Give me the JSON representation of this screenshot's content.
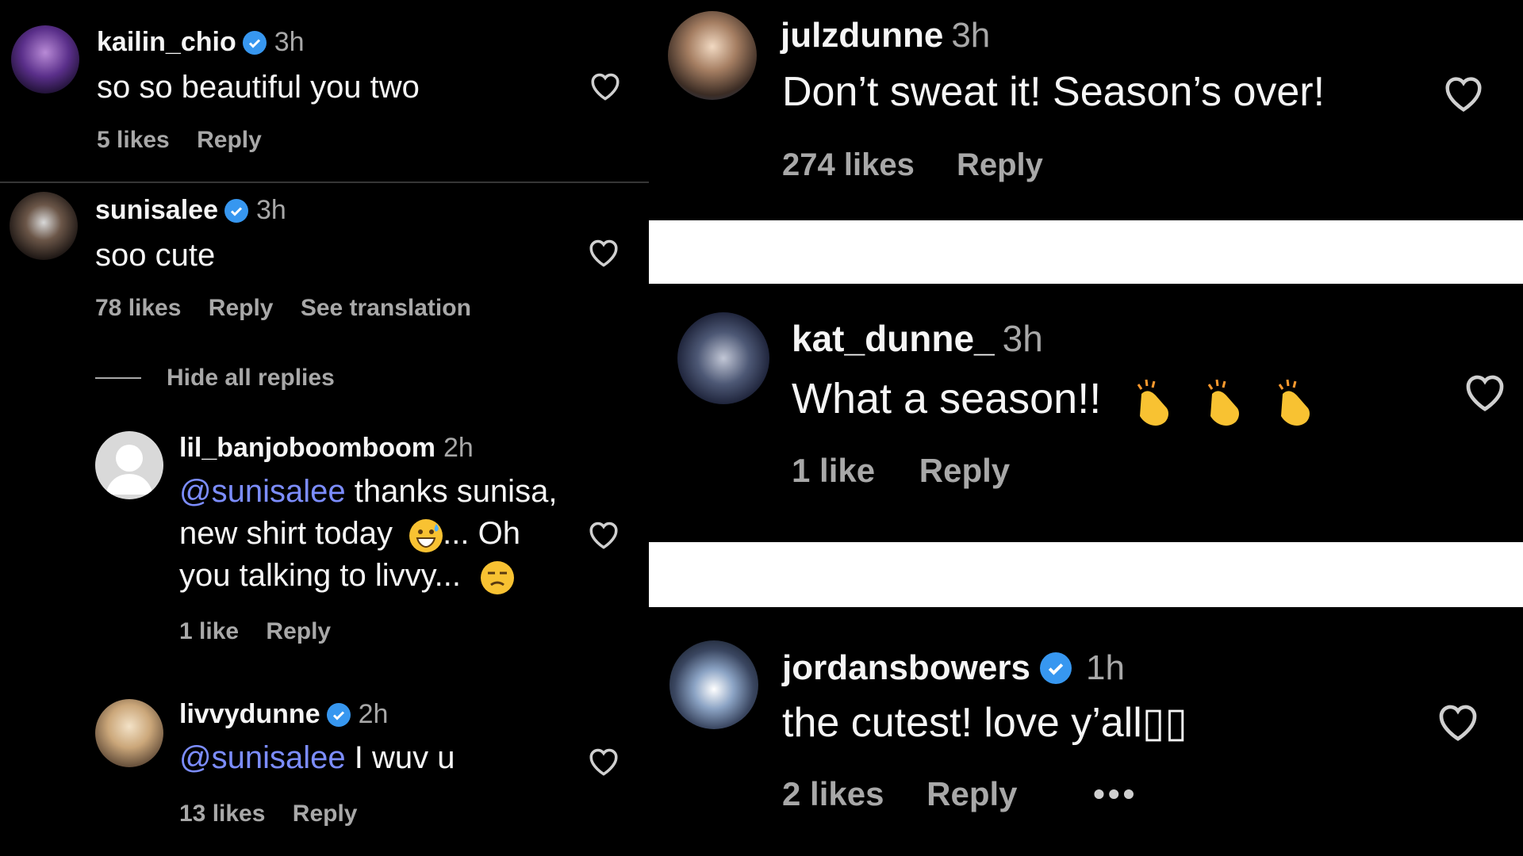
{
  "left_panel": {
    "comments": [
      {
        "username": "kailin_chio",
        "verified": true,
        "time": "3h",
        "text": "so so beautiful you two",
        "likes": "5 likes",
        "reply": "Reply"
      },
      {
        "username": "sunisalee",
        "verified": true,
        "time": "3h",
        "text": "soo cute",
        "likes": "78 likes",
        "reply": "Reply",
        "translation": "See translation",
        "hide_replies": "Hide all replies"
      }
    ],
    "replies": [
      {
        "username": "lil_banjoboomboom",
        "verified": false,
        "time": "2h",
        "mention": "@sunisalee",
        "text_line1": " thanks sunisa,",
        "text_line2": "new shirt today",
        "text_line2b": "... Oh",
        "text_line3": "you talking to livvy...",
        "likes": "1 like",
        "reply": "Reply"
      },
      {
        "username": "livvydunne",
        "verified": true,
        "time": "2h",
        "mention": "@sunisalee",
        "text": " I wuv u",
        "likes": "13 likes",
        "reply": "Reply"
      }
    ]
  },
  "right_panels": [
    {
      "username": "julzdunne",
      "verified": false,
      "time": "3h",
      "text": "Don’t sweat it! Season’s over!",
      "likes": "274 likes",
      "reply": "Reply"
    },
    {
      "username": "kat_dunne_",
      "verified": false,
      "time": "3h",
      "text": "What a season!!",
      "likes": "1 like",
      "reply": "Reply",
      "emoji": "clapping-hands"
    },
    {
      "username": "jordansbowers",
      "verified": true,
      "time": "1h",
      "text": "the cutest! love y’all",
      "unrendered_glyphs": "▯▯",
      "likes": "2 likes",
      "reply": "Reply",
      "more": "•••"
    }
  ],
  "colors": {
    "background": "#000000",
    "text": "#f5f5f5",
    "muted": "#a8a8a8",
    "mention": "#7c8dff",
    "verified": "#3797f0"
  }
}
